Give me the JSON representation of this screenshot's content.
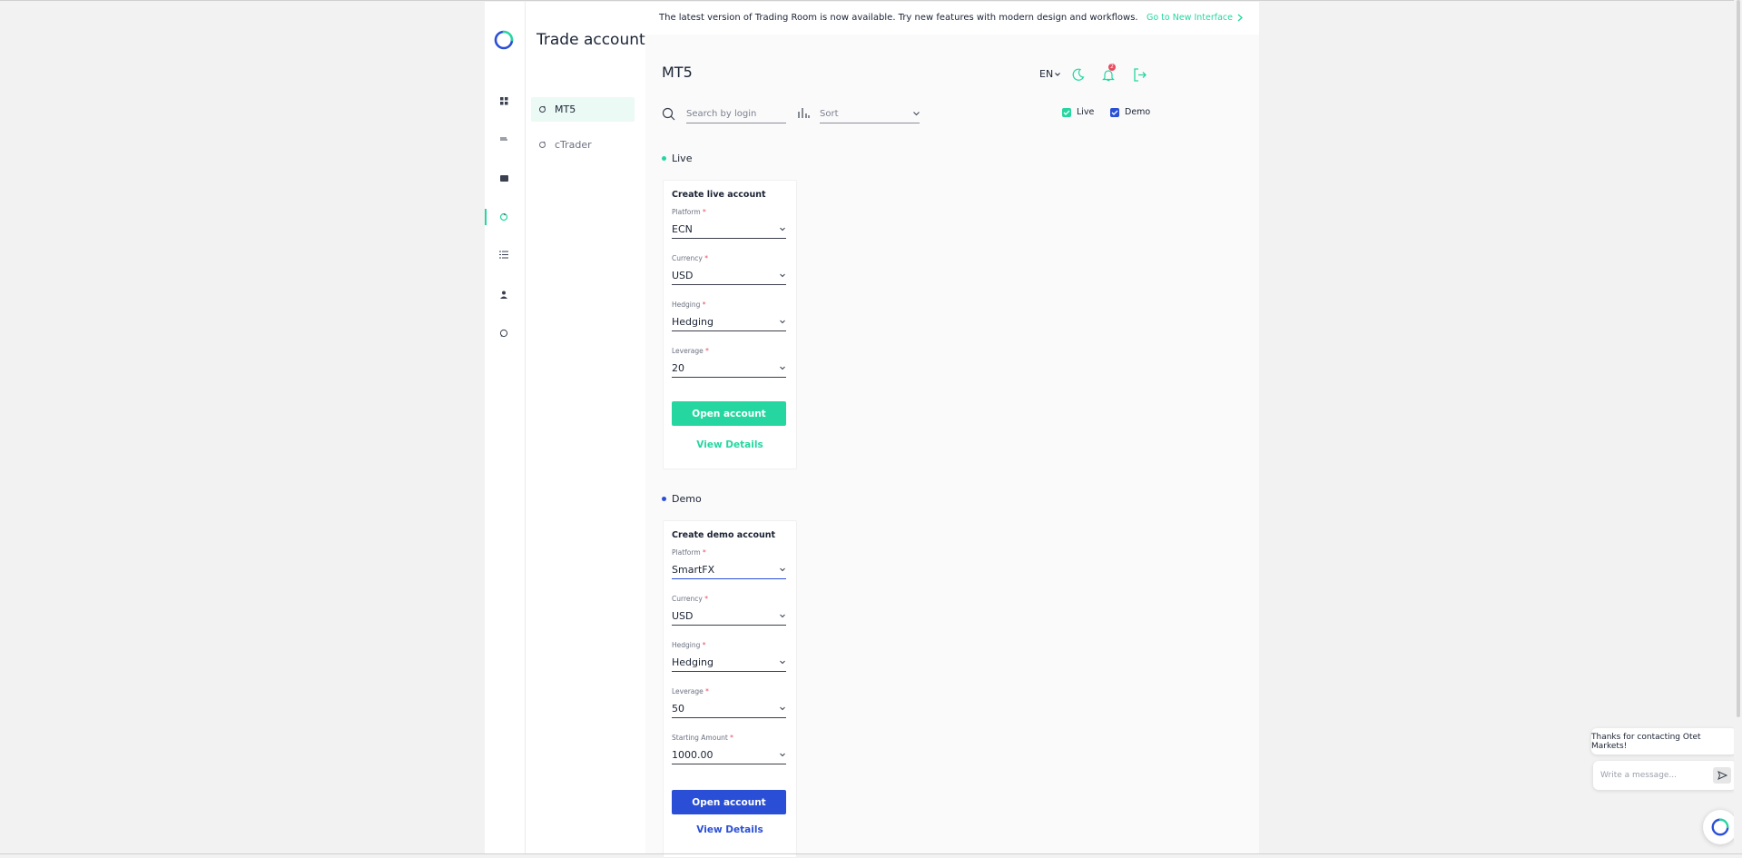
{
  "app": {
    "title": "Trade accounts",
    "accent": "#26d6a0",
    "demo_accent": "#2a4fd6"
  },
  "rail": {
    "items": [
      {
        "name": "dashboard-icon"
      },
      {
        "name": "transfer-icon"
      },
      {
        "name": "wallet-icon"
      },
      {
        "name": "trade-accounts-icon",
        "active": true
      },
      {
        "name": "list-icon"
      },
      {
        "name": "profile-icon"
      },
      {
        "name": "chat-icon"
      }
    ]
  },
  "subnav": {
    "items": [
      {
        "label": "MT5",
        "active": true
      },
      {
        "label": "cTrader",
        "active": false
      }
    ]
  },
  "banner": {
    "text": "The latest version of Trading Room is now available. Try new features with modern design and workflows.",
    "link": "Go to New Interface"
  },
  "header": {
    "title": "MT5",
    "lang": "EN",
    "notifications_count": "2"
  },
  "toolbar": {
    "search_placeholder": "Search by login",
    "sort_placeholder": "Sort",
    "filter_live": "Live",
    "filter_demo": "Demo",
    "filter_live_checked": true,
    "filter_demo_checked": true
  },
  "live": {
    "section_label": "Live",
    "card_title": "Create live account",
    "fields": [
      {
        "label": "Platform",
        "value": "ECN"
      },
      {
        "label": "Currency",
        "value": "USD"
      },
      {
        "label": "Hedging",
        "value": "Hedging"
      },
      {
        "label": "Leverage",
        "value": "20"
      }
    ],
    "button": "Open account",
    "link": "View Details"
  },
  "demo": {
    "section_label": "Demo",
    "card_title": "Create demo account",
    "fields": [
      {
        "label": "Platform",
        "value": "SmartFX"
      },
      {
        "label": "Currency",
        "value": "USD"
      },
      {
        "label": "Hedging",
        "value": "Hedging"
      },
      {
        "label": "Leverage",
        "value": "50"
      },
      {
        "label": "Starting Amount",
        "value": "1000.00"
      }
    ],
    "button": "Open account",
    "link": "View Details"
  },
  "chat": {
    "greeting": "Thanks for contacting Otet Markets!",
    "placeholder": "Write a message..."
  }
}
